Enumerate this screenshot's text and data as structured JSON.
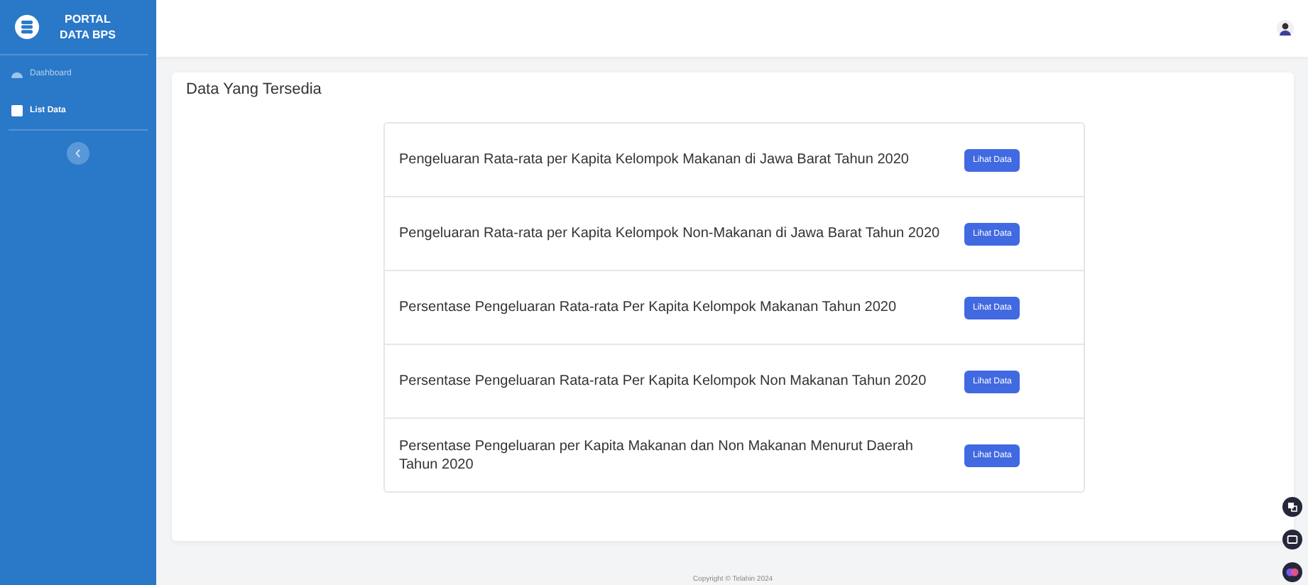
{
  "brand": {
    "line1": "PORTAL",
    "line2": "DATA BPS"
  },
  "sidebar": {
    "items": [
      {
        "label": "Dashboard",
        "selected": false
      },
      {
        "label": "List Data",
        "selected": true
      }
    ]
  },
  "card": {
    "title": "Data Yang Tersedia",
    "rows": [
      {
        "title": "Pengeluaran Rata-rata per Kapita Kelompok Makanan di Jawa Barat Tahun 2020",
        "button": "Lihat Data"
      },
      {
        "title": "Pengeluaran Rata-rata per Kapita Kelompok Non-Makanan di Jawa Barat Tahun 2020",
        "button": "Lihat Data"
      },
      {
        "title": "Persentase Pengeluaran Rata-rata Per Kapita Kelompok Makanan Tahun 2020",
        "button": "Lihat Data"
      },
      {
        "title": "Persentase Pengeluaran Rata-rata Per Kapita Kelompok Non Makanan Tahun 2020",
        "button": "Lihat Data"
      },
      {
        "title": "Persentase Pengeluaran per Kapita Makanan dan Non Makanan Menurut Daerah Tahun 2020",
        "button": "Lihat Data"
      }
    ]
  },
  "footer": "Copyright © Telahin 2024"
}
